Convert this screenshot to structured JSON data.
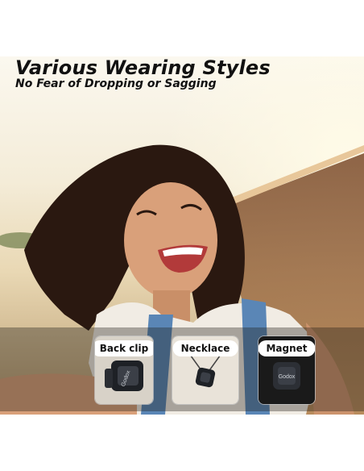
{
  "header": {
    "title": "Various Wearing Styles",
    "subtitle": "No Fear of Dropping or Sagging"
  },
  "styles": [
    {
      "label": "Back clip"
    },
    {
      "label": "Necklace"
    },
    {
      "label": "Magnet"
    }
  ],
  "device_brand_text": "Godox",
  "colors": {
    "title_text": "#111111",
    "pill_background": "#ffffff",
    "device_body": "#1e2126"
  }
}
